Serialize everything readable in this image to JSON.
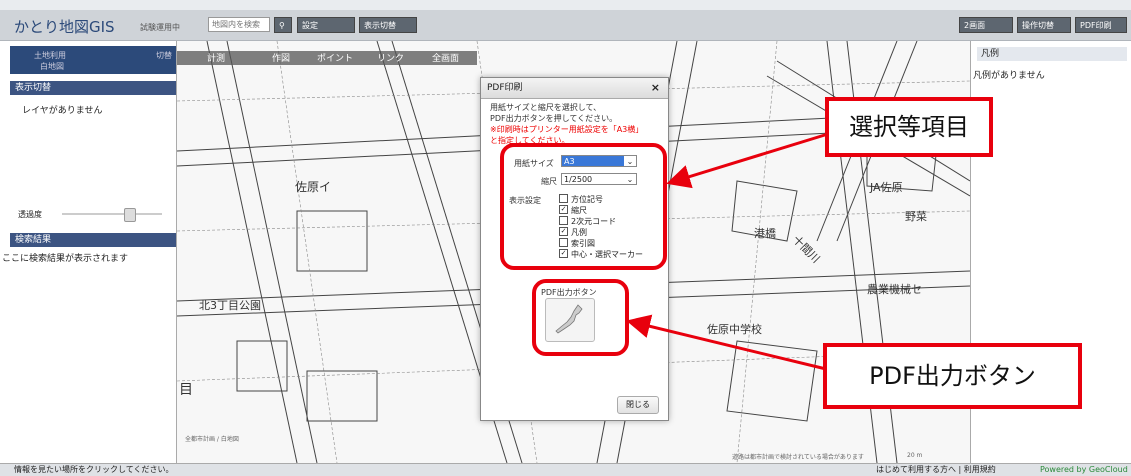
{
  "header": {
    "app_title": "かとり地図GIS",
    "app_sub": "試験運用中",
    "search_placeholder": "地図内を検索",
    "buttons": [
      "設定",
      "表示切替"
    ],
    "right_buttons": [
      "2画面",
      "操作切替",
      "PDF印刷"
    ]
  },
  "left": {
    "layer_name_1": "土地利用",
    "layer_name_2": "白地図",
    "switch_label": "切替",
    "display_switch": "表示切替",
    "no_layer": "レイヤがありません",
    "transparency": "透過度",
    "search_result": "検索結果",
    "search_hint": "ここに検索結果が表示されます"
  },
  "map_toolbar": [
    "計測",
    "作図",
    "ポイント",
    "リンク",
    "全画面"
  ],
  "map_labels": [
    "佐原イ",
    "北3丁目公園",
    "佐原中学校",
    "港橋",
    "十間川",
    "JA佐原",
    "野菜",
    "農業機械セ",
    "目",
    "全都市計画 / 白地図"
  ],
  "map_footer": "道路は都市計画で検討されている場合があります",
  "scale": "20 m",
  "right": {
    "legend_title": "凡例",
    "legend_empty": "凡例がありません"
  },
  "status": {
    "left": "情報を見たい場所をクリックしてください。",
    "right": "はじめて利用する方へ | 利用規約",
    "powered": "Powered by GeoCloud"
  },
  "dialog": {
    "title": "PDF印刷",
    "close": "×",
    "line1": "用紙サイズと縮尺を選択して、",
    "line2": "PDF出力ボタンを押してください。",
    "warn1": "※印刷時はプリンター用紙設定を「A3横」",
    "warn2": "と指定してください。",
    "paper_label": "用紙サイズ",
    "paper_value": "A3",
    "scale_label": "縮尺",
    "scale_value": "1/2500",
    "display_label": "表示設定",
    "options": [
      {
        "label": "方位記号",
        "checked": false
      },
      {
        "label": "縮尺",
        "checked": true
      },
      {
        "label": "2次元コード",
        "checked": false
      },
      {
        "label": "凡例",
        "checked": true
      },
      {
        "label": "索引図",
        "checked": false
      },
      {
        "label": "中心・選択マーカー",
        "checked": true
      }
    ],
    "pdf_button_label": "PDF出力ボタン",
    "close_button": "閉じる"
  },
  "annotations": {
    "callout_select": "選択等項目",
    "callout_pdf": "PDF出力ボタン",
    "accent_color": "#e8000d"
  }
}
